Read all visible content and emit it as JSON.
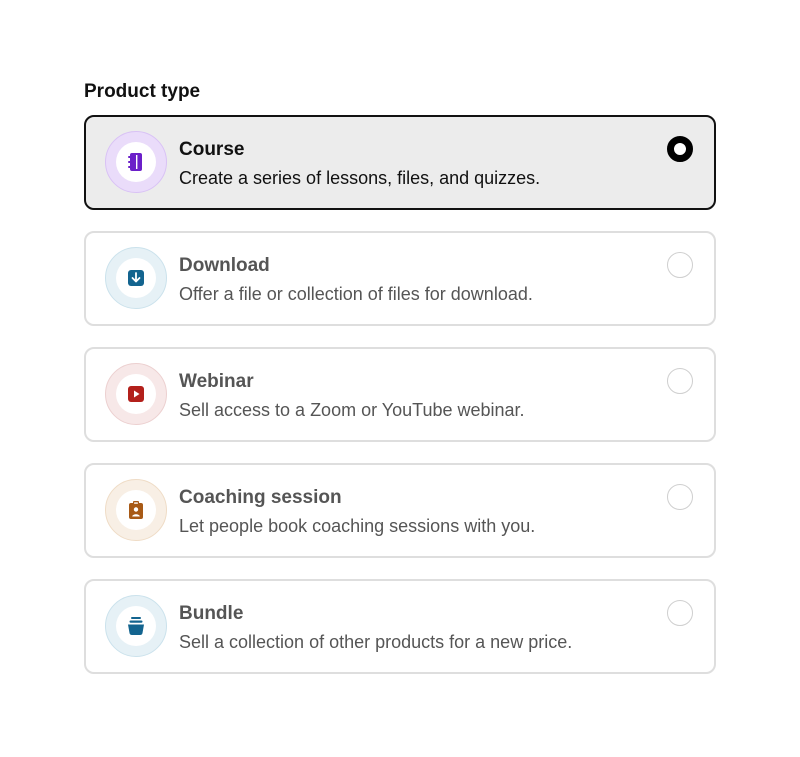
{
  "heading": "Product type",
  "options": [
    {
      "title": "Course",
      "description": "Create a series of lessons, files, and quizzes.",
      "icon": "notebook-icon",
      "selected": true,
      "ring_color": "#eadcfa",
      "ring_border": "#d9c2f5",
      "icon_color": "#6b1fc9"
    },
    {
      "title": "Download",
      "description": "Offer a file or collection of files for download.",
      "icon": "download-icon",
      "selected": false,
      "ring_color": "#e6f1f6",
      "ring_border": "#cbe2ec",
      "icon_color": "#13648f"
    },
    {
      "title": "Webinar",
      "description": "Sell access to a Zoom or YouTube webinar.",
      "icon": "video-play-icon",
      "selected": false,
      "ring_color": "#f7e8e8",
      "ring_border": "#ecd0d0",
      "icon_color": "#b3201b"
    },
    {
      "title": "Coaching session",
      "description": "Let people book coaching sessions with you.",
      "icon": "clipboard-person-icon",
      "selected": false,
      "ring_color": "#f8efe5",
      "ring_border": "#efdcc6",
      "icon_color": "#a85a16"
    },
    {
      "title": "Bundle",
      "description": "Sell a collection of other products for a new price.",
      "icon": "stack-icon",
      "selected": false,
      "ring_color": "#e6f1f6",
      "ring_border": "#cbe2ec",
      "icon_color": "#13648f"
    }
  ]
}
